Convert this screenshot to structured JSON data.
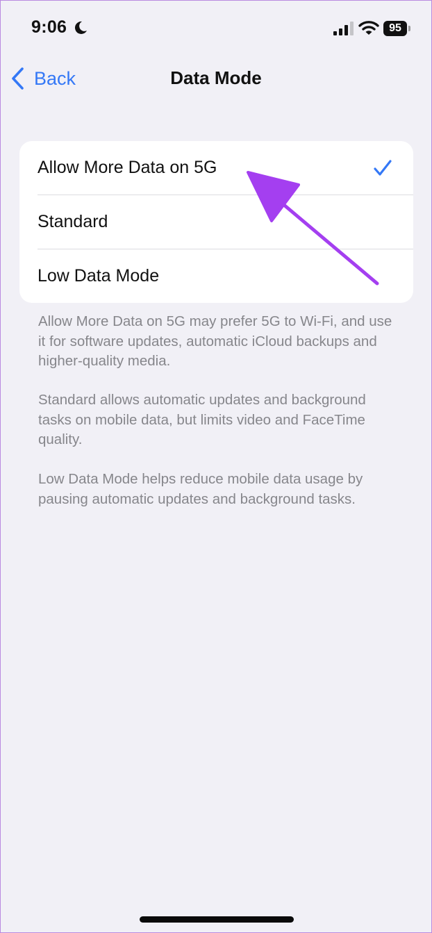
{
  "status_bar": {
    "time": "9:06",
    "battery_level": "95",
    "icons": [
      "moon-icon",
      "signal-icon",
      "wifi-icon",
      "battery-icon"
    ]
  },
  "nav": {
    "back_label": "Back",
    "title": "Data Mode"
  },
  "options": [
    {
      "label": "Allow More Data on 5G",
      "selected": true
    },
    {
      "label": "Standard",
      "selected": false
    },
    {
      "label": "Low Data Mode",
      "selected": false
    }
  ],
  "descriptions": [
    "Allow More Data on 5G may prefer 5G to Wi-Fi, and use it for software updates, automatic iCloud backups and higher-quality media.",
    "Standard allows automatic updates and background tasks on mobile data, but limits video and FaceTime quality.",
    "Low Data Mode helps reduce mobile data usage by pausing automatic updates and background tasks."
  ],
  "colors": {
    "accent": "#3478f6",
    "background": "#f1f0f6",
    "annotation": "#a43ff0"
  }
}
